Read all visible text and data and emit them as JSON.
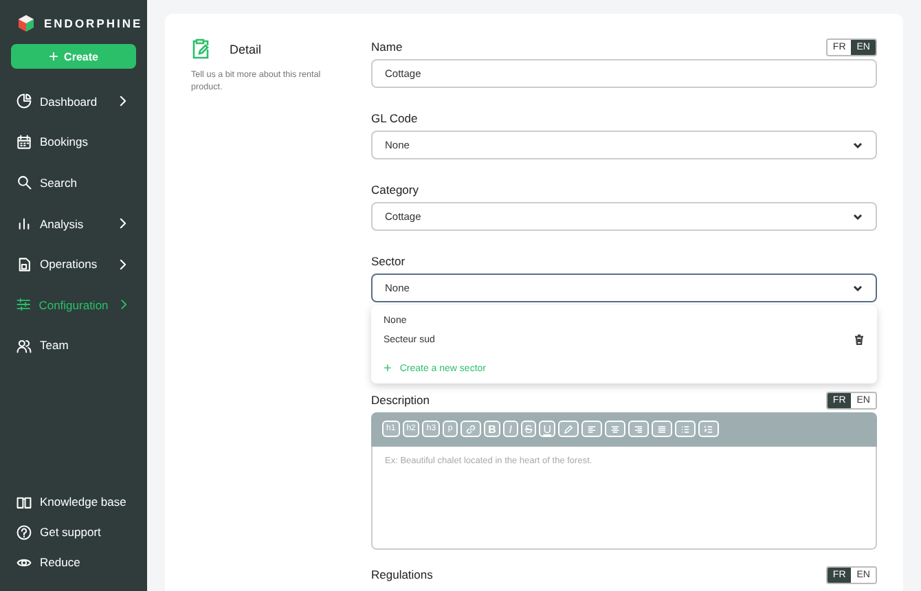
{
  "sidebar": {
    "brand": "ENDORPHINE",
    "create_button": {
      "icon": "+",
      "label": "Create"
    },
    "items": [
      {
        "label": "Dashboard",
        "has_submenu": true,
        "selected": false
      },
      {
        "label": "Bookings",
        "has_submenu": false,
        "selected": false
      },
      {
        "label": "Search",
        "has_submenu": false,
        "selected": false
      },
      {
        "label": "Analysis",
        "has_submenu": true,
        "selected": false
      },
      {
        "label": "Operations",
        "has_submenu": true,
        "selected": false
      },
      {
        "label": "Configuration",
        "has_submenu": true,
        "selected": true
      },
      {
        "label": "Team",
        "has_submenu": false,
        "selected": false
      }
    ],
    "footer_items": [
      {
        "label": "Knowledge base"
      },
      {
        "label": "Get support"
      },
      {
        "label": "Reduce"
      }
    ]
  },
  "section": {
    "title": "Detail",
    "description": "Tell us a bit more about this rental product."
  },
  "form": {
    "fields": [
      {
        "label": "Name",
        "kind": "text",
        "value": "Cottage",
        "languages": [
          {
            "code": "FR",
            "selected": false
          },
          {
            "code": "EN",
            "selected": true
          }
        ]
      },
      {
        "label": "GL Code",
        "kind": "select",
        "value": "None",
        "focused": false
      },
      {
        "label": "Category",
        "kind": "select",
        "value": "Cottage",
        "focused": false
      },
      {
        "label": "Sector",
        "kind": "select",
        "value": "None",
        "focused": true,
        "dropdown": {
          "options": [
            {
              "label": "None",
              "deletable": false
            },
            {
              "label": "Secteur sud",
              "deletable": true
            }
          ],
          "create_label": "Create a new sector",
          "create_icon": "+"
        }
      },
      {
        "label": "Description",
        "kind": "rich",
        "placeholder": "Ex: Beautiful chalet located in the heart of the forest.",
        "languages": [
          {
            "code": "FR",
            "selected": true
          },
          {
            "code": "EN",
            "selected": false
          }
        ],
        "toolbar": [
          {
            "kind": "text",
            "text": "h1"
          },
          {
            "kind": "text",
            "text": "h2"
          },
          {
            "kind": "text",
            "text": "h3"
          },
          {
            "kind": "text",
            "text": "p"
          },
          {
            "kind": "icon"
          },
          {
            "kind": "text",
            "text": "B"
          },
          {
            "kind": "text",
            "text": "I"
          },
          {
            "kind": "text",
            "text": "S"
          },
          {
            "kind": "text",
            "text": "U"
          },
          {
            "kind": "icon"
          },
          {
            "kind": "icon"
          },
          {
            "kind": "icon"
          },
          {
            "kind": "icon"
          },
          {
            "kind": "icon"
          },
          {
            "kind": "icon"
          },
          {
            "kind": "icon"
          }
        ]
      },
      {
        "label": "Regulations",
        "kind": "heading",
        "languages": [
          {
            "code": "FR",
            "selected": true
          },
          {
            "code": "EN",
            "selected": false
          }
        ]
      }
    ]
  }
}
